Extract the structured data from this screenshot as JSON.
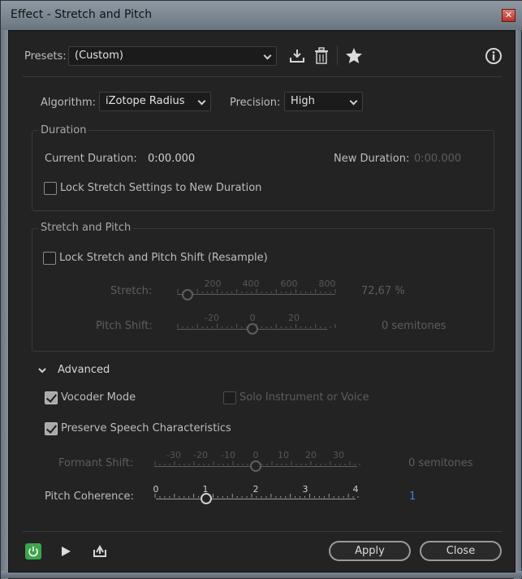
{
  "window": {
    "title": "Effect - Stretch and Pitch",
    "close_glyph": "✕"
  },
  "presets": {
    "label": "Presets:",
    "value": "(Custom)"
  },
  "toolbar": {
    "save_icon": "download-icon",
    "delete_icon": "trash-icon",
    "favorite_icon": "star-icon",
    "info_icon": "info-icon"
  },
  "algorithm": {
    "label": "Algorithm:",
    "value": "iZotope Radius"
  },
  "precision": {
    "label": "Precision:",
    "value": "High"
  },
  "duration": {
    "title": "Duration",
    "current_label": "Current Duration:",
    "current_value": "0:00.000",
    "new_label": "New Duration:",
    "new_value": "0:00.000",
    "lock_label": "Lock Stretch Settings to New Duration",
    "lock_checked": false
  },
  "stretch_pitch": {
    "title": "Stretch and Pitch",
    "lock_label": "Lock Stretch and Pitch Shift (Resample)",
    "lock_checked": false,
    "stretch": {
      "label": "Stretch:",
      "ticks": [
        "200",
        "400",
        "600",
        "800"
      ],
      "value_text": "72,67 %"
    },
    "pitch": {
      "label": "Pitch Shift:",
      "ticks": [
        "-20",
        "0",
        "20"
      ],
      "value_text": "0 semitones"
    }
  },
  "advanced": {
    "title": "Advanced",
    "vocoder_label": "Vocoder Mode",
    "vocoder_checked": true,
    "solo_label": "Solo Instrument or Voice",
    "solo_checked": false,
    "preserve_label": "Preserve Speech Characteristics",
    "preserve_checked": true,
    "formant": {
      "label": "Formant Shift:",
      "ticks": [
        "-30",
        "-20",
        "-10",
        "0",
        "10",
        "20",
        "30"
      ],
      "value_text": "0 semitones"
    },
    "coherence": {
      "label": "Pitch Coherence:",
      "ticks": [
        "0",
        "1",
        "2",
        "3",
        "4"
      ],
      "value_text": "1",
      "value": 1,
      "min": 0,
      "max": 4
    }
  },
  "footer": {
    "power_icon": "power-icon",
    "play_icon": "play-icon",
    "export_icon": "export-icon",
    "apply_label": "Apply",
    "close_label": "Close"
  },
  "colors": {
    "accent_blue": "#2d8ceb",
    "power_green": "#3aa64a"
  }
}
